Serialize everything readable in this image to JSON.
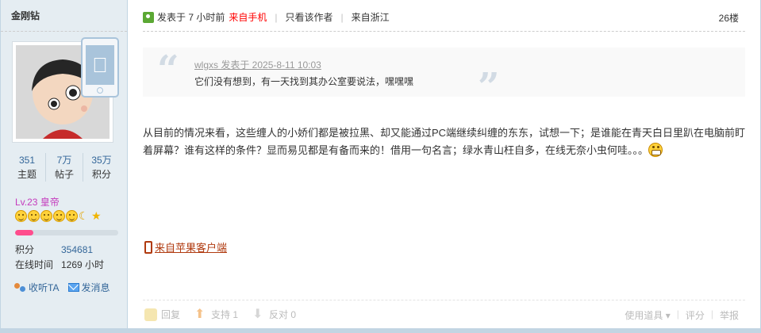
{
  "author": {
    "name": "金刚钻",
    "stats": [
      {
        "value": "351",
        "label": "主题"
      },
      {
        "value": "7万",
        "label": "帖子"
      },
      {
        "value": "35万",
        "label": "积分"
      }
    ],
    "level": "Lv.23 皇帝",
    "level_progress": 0.18,
    "points_label": "积分",
    "points_value": "354681",
    "online_label": "在线时间",
    "online_value": "1269 小时",
    "follow_label": "收听TA",
    "message_label": "发消息"
  },
  "post": {
    "posted_prefix": "发表于 7 小时前",
    "from_mobile": "来自手机",
    "only_author": "只看该作者",
    "location": "来自浙江",
    "floor": "26楼",
    "quote": {
      "author_line": "wlgxs 发表于 2025-8-11 10:03",
      "text": "它们没有想到，有一天找到其办公室要说法，嘿嘿嘿"
    },
    "content": "从目前的情况来看，这些缠人的小娇们都是被拉黑、却又能通过PC端继续纠缠的东东，试想一下；是谁能在青天白日里趴在电脑前盯着屏幕？谁有这样的条件？显而易见都是有备而来的！借用一句名言；绿水青山枉自多，在线无奈小虫何哇。。。",
    "client_link": "来自苹果客户端"
  },
  "actions": {
    "reply": "回复",
    "support": "支持 1",
    "oppose": "反对 0",
    "tools": "使用道具",
    "rate": "评分",
    "report": "举报"
  }
}
